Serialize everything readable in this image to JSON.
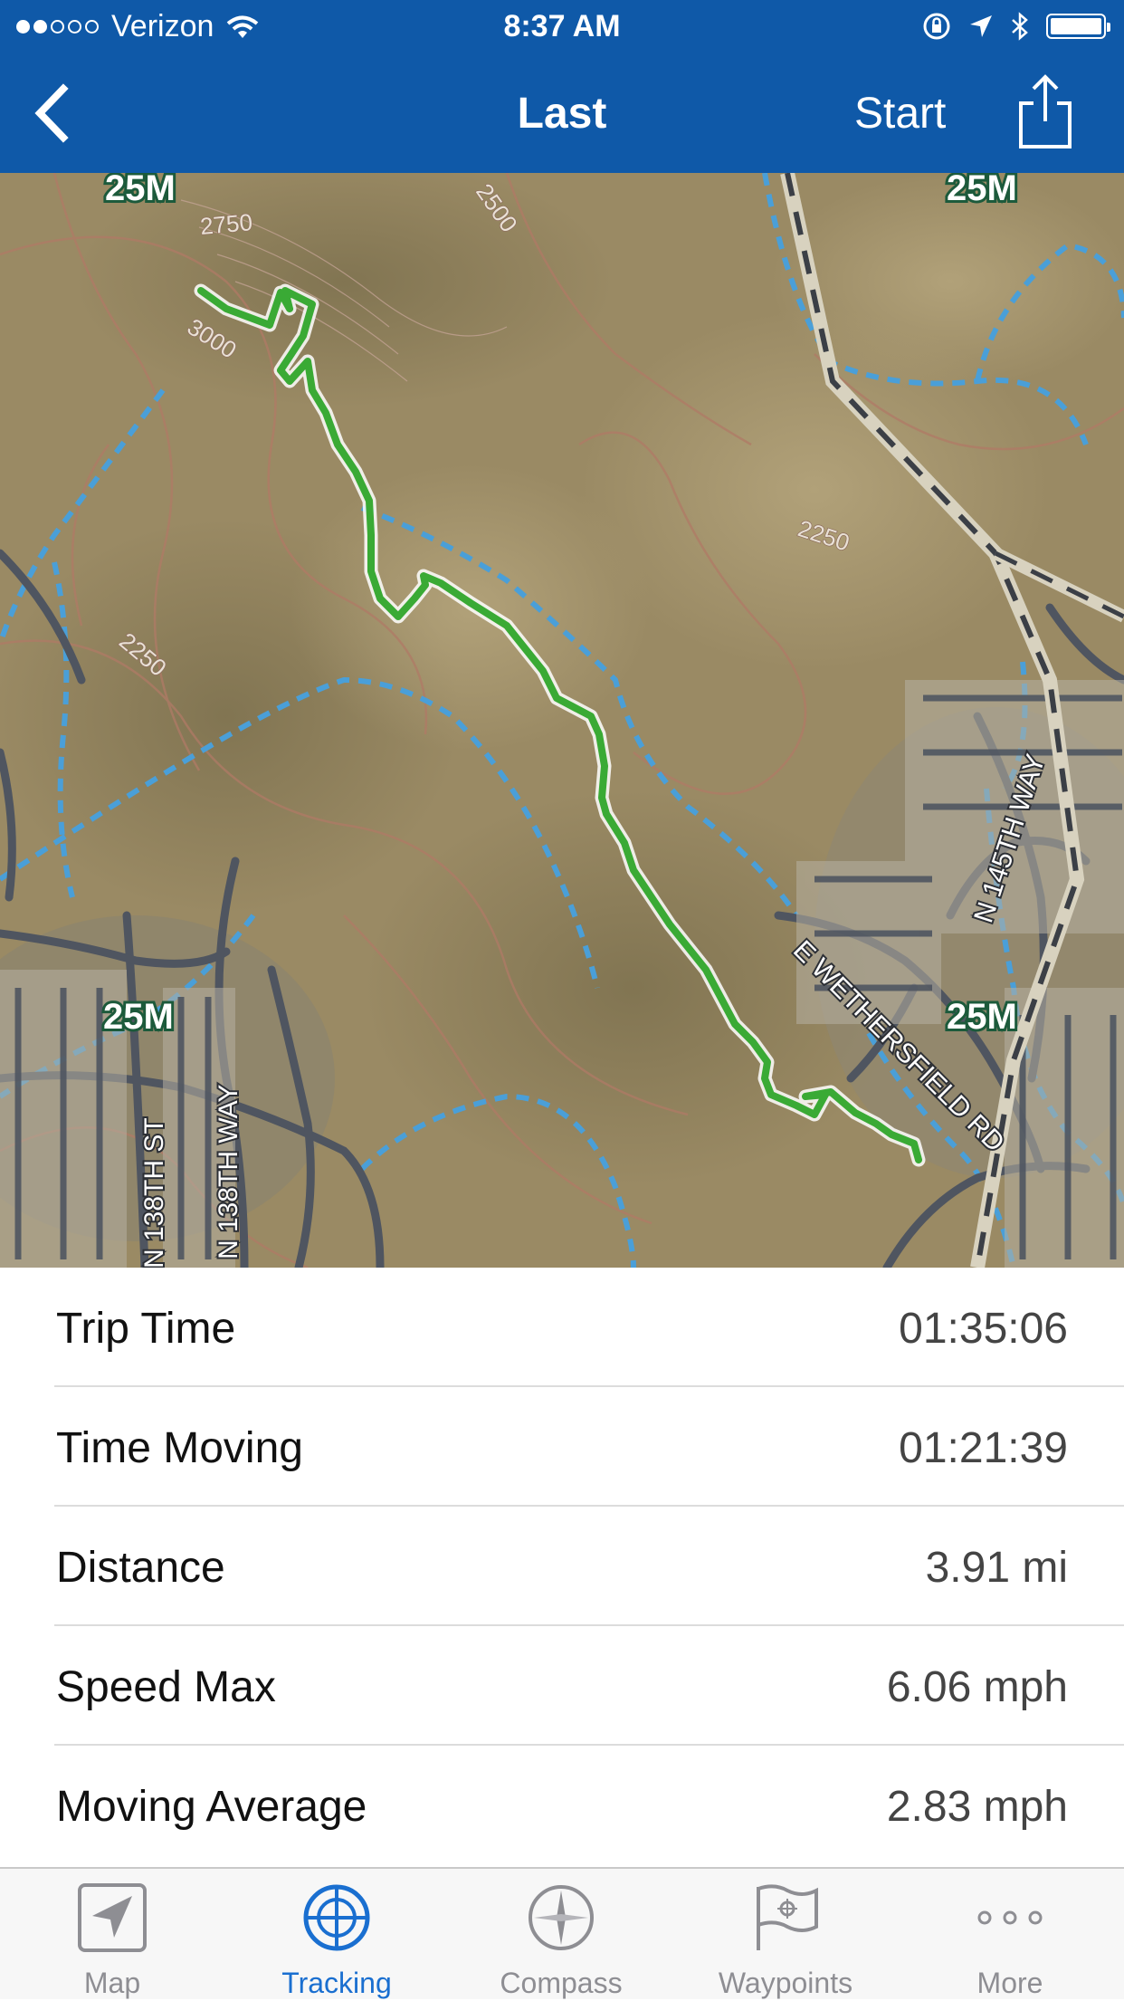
{
  "status_bar": {
    "carrier": "Verizon",
    "time": "8:37 AM"
  },
  "nav": {
    "title": "Last",
    "start_label": "Start",
    "back_icon": "chevron-left-icon",
    "share_icon": "share-icon"
  },
  "map": {
    "labels": {
      "zone_a": "25M",
      "zone_b": "25M",
      "zone_c": "25M",
      "zone_d": "25M",
      "contour_2750": "2750",
      "contour_3000": "3000",
      "contour_2500": "2500",
      "contour_2250_a": "2250",
      "contour_2250_b": "2250",
      "street_145th": "N 145TH WAY",
      "street_wethersfield": "E WETHERSFIELD RD",
      "street_138th_st": "N 138TH ST",
      "street_138th_way": "N 138TH WAY"
    },
    "track_color": "#3aaa35"
  },
  "stats": [
    {
      "label": "Trip Time",
      "value": "01:35:06"
    },
    {
      "label": "Time Moving",
      "value": "01:21:39"
    },
    {
      "label": "Distance",
      "value": "3.91 mi"
    },
    {
      "label": "Speed Max",
      "value": "6.06 mph"
    },
    {
      "label": "Moving Average",
      "value": "2.83 mph"
    }
  ],
  "tabs": [
    {
      "label": "Map",
      "icon": "navigation-arrow-icon",
      "active": false
    },
    {
      "label": "Tracking",
      "icon": "crosshair-circle-icon",
      "active": true
    },
    {
      "label": "Compass",
      "icon": "compass-icon",
      "active": false
    },
    {
      "label": "Waypoints",
      "icon": "flag-icon",
      "active": false
    },
    {
      "label": "More",
      "icon": "more-dots-icon",
      "active": false
    }
  ],
  "colors": {
    "header_blue": "#0f59a8",
    "active_tab": "#1a6fd0",
    "inactive_tab": "#8e8e93"
  }
}
